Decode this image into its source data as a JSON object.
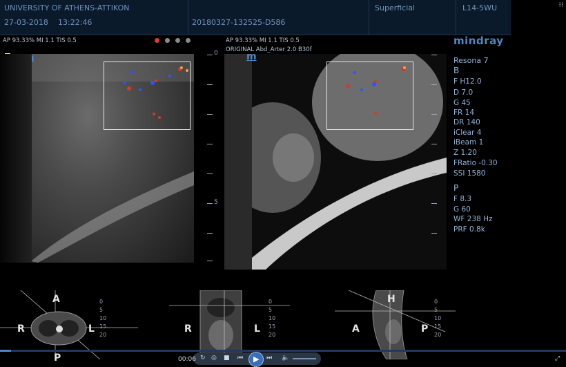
{
  "header": {
    "institution": "UNIVERSITY OF ATHENS-ATTIKON",
    "date": "27-03-2018",
    "time": "13:22:46",
    "patient_id": "20180327-132525-D586",
    "preset": "Superficial",
    "probe": "L14-5WU"
  },
  "left_panel": {
    "info": "AP 93.33%  MI 1.1 TIS 0.5",
    "mode_icon": "m",
    "page_dots": 4,
    "active_dot": 0
  },
  "right_panel": {
    "info": "AP 93.33%  MI 1.1 TIS 0.5",
    "fusion_info": "ORIGINAL  Abd_Arter  2.0  B30f",
    "mode_icon": "m"
  },
  "depth_scale": {
    "top": "0",
    "mid": "5"
  },
  "sidebar": {
    "brand": "mindray",
    "model": "Resona 7",
    "b_mode": {
      "title": "B",
      "params": [
        "F H12.0",
        "D 7.0",
        "G 45",
        "FR 14",
        "DR 140",
        "iClear 4",
        "iBeam 1",
        "Z 1.20",
        "FRatio -0.30",
        "SSI 1580"
      ]
    },
    "p_mode": {
      "title": "P",
      "params": [
        "F 8.3",
        "G 60",
        "WF 238 Hz",
        "PRF 0.8k"
      ]
    }
  },
  "mini_views": [
    {
      "top": "A",
      "left": "R",
      "right": "L",
      "bottom": "P",
      "scale": [
        "0",
        "5",
        "10",
        "15",
        "20"
      ]
    },
    {
      "left": "R",
      "right": "L",
      "scale": [
        "0",
        "5",
        "10",
        "15",
        "20"
      ]
    },
    {
      "top": "H",
      "left": "A",
      "right": "P",
      "scale": [
        "0",
        "5",
        "10",
        "15",
        "20"
      ]
    }
  ],
  "playback": {
    "elapsed": "00:06",
    "progress": 0.02
  },
  "colors": {
    "header_bg": "#0b1a2a",
    "accent": "#4f86c6",
    "text": "#8fb3d9",
    "active_dot": "#e23b2e",
    "inactive_dot": "#8a8a8a"
  }
}
